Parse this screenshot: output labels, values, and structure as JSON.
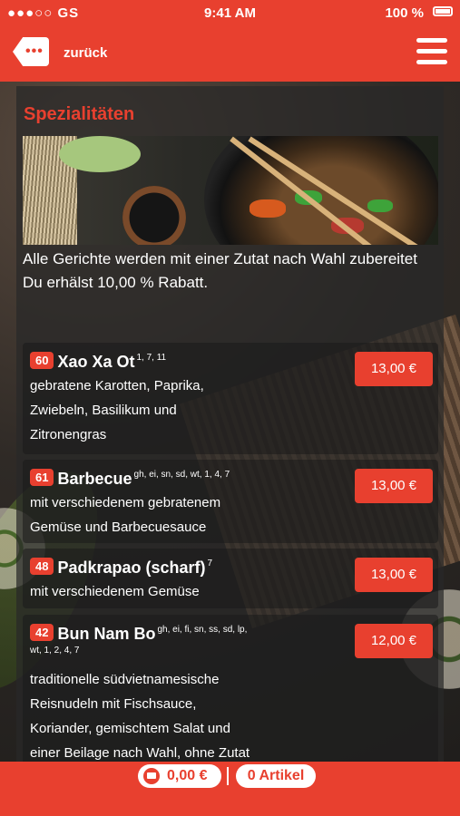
{
  "status_bar": {
    "carrier": "●●●○○ GS",
    "time": "9:41 AM",
    "battery": "100 %"
  },
  "nav": {
    "back_label": "zurück",
    "back_icon": "chat-back-icon",
    "menu_icon": "hamburger-menu-icon"
  },
  "section": {
    "title": "Spezialitäten",
    "intro_line1": "Alle Gerichte werden mit einer Zutat nach Wahl zubereitet",
    "intro_line2": "Du erhälst 10,00 % Rabatt."
  },
  "items": [
    {
      "num": "60",
      "name": "Xao Xa Ot",
      "allergens": "1, 7, 11",
      "desc": [
        "gebratene Karotten, Paprika,",
        "Zwiebeln, Basilikum und",
        "Zitronengras"
      ],
      "price": "13,00 €"
    },
    {
      "num": "61",
      "name": "Barbecue",
      "allergens": "gh, ei, sn, sd, wt, 1, 4, 7",
      "desc": [
        "mit verschiedenem gebratenem",
        "Gemüse und Barbecuesauce"
      ],
      "price": "13,00 €"
    },
    {
      "num": "48",
      "name": "Padkrapao (scharf)",
      "allergens": "7",
      "desc": [
        "mit verschiedenem Gemüse"
      ],
      "price": "13,00 €"
    },
    {
      "num": "42",
      "name": "Bun Nam Bo",
      "allergens": "gh, ei, fi, sn, ss, sd, lp,",
      "allergens2": "wt, 1, 2, 4, 7",
      "desc": [
        "traditionelle südvietnamesische",
        "Reisnudeln mit Fischsauce,",
        "Koriander, gemischtem Salat und",
        "einer Beilage nach Wahl, ohne Zutat"
      ],
      "price": "12,00 €"
    }
  ],
  "footer": {
    "cart_total": "0,00 €",
    "article_count": "0 Artikel",
    "cart_icon": "cart-icon"
  },
  "colors": {
    "accent": "#e8402f",
    "panel": "#2b2a28"
  }
}
